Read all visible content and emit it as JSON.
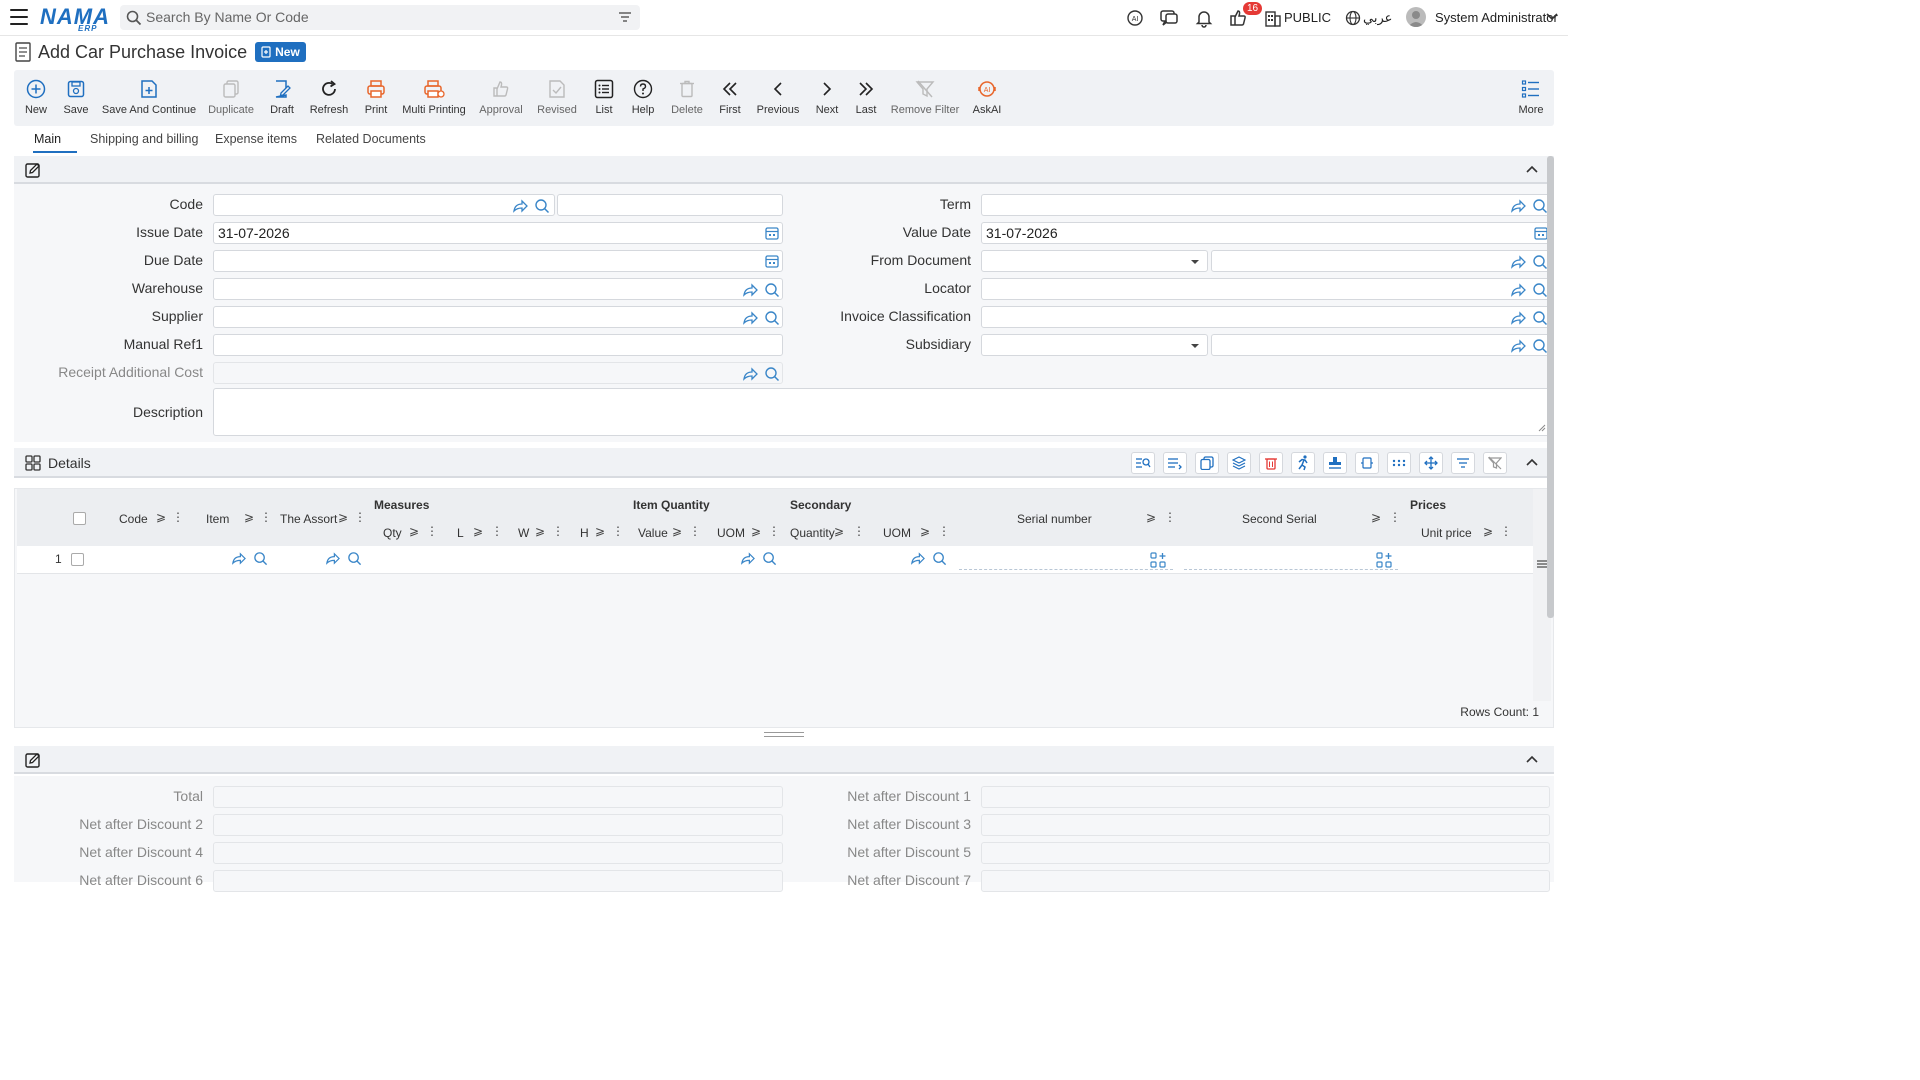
{
  "app": {
    "logo": "NAMA",
    "logo_sub": "ERP"
  },
  "search": {
    "placeholder": "Search By Name Or Code"
  },
  "topbar": {
    "notification_count": "16",
    "public_label": "PUBLIC",
    "language_label": "عربي",
    "user_name": "System Administrator"
  },
  "page": {
    "title": "Add Car Purchase Invoice",
    "status_badge": "New"
  },
  "toolbar": {
    "new": "New",
    "save": "Save",
    "save_continue": "Save And Continue",
    "duplicate": "Duplicate",
    "draft": "Draft",
    "refresh": "Refresh",
    "print": "Print",
    "multi_printing": "Multi Printing",
    "approval": "Approval",
    "revised": "Revised",
    "list": "List",
    "help": "Help",
    "delete": "Delete",
    "first": "First",
    "previous": "Previous",
    "next": "Next",
    "last": "Last",
    "remove_filter": "Remove Filter",
    "askai": "AskAI",
    "more": "More"
  },
  "tabs": [
    "Main",
    "Shipping and billing",
    "Expense items",
    "Related Documents"
  ],
  "form": {
    "code": {
      "label": "Code",
      "value": ""
    },
    "issue_date": {
      "label": "Issue Date",
      "value": "31-07-2026"
    },
    "due_date": {
      "label": "Due Date",
      "value": ""
    },
    "warehouse": {
      "label": "Warehouse",
      "value": ""
    },
    "supplier": {
      "label": "Supplier",
      "value": ""
    },
    "manual_ref1": {
      "label": "Manual Ref1",
      "value": ""
    },
    "receipt_additional_cost": {
      "label": "Receipt Additional Cost",
      "value": ""
    },
    "description": {
      "label": "Description",
      "value": ""
    },
    "term": {
      "label": "Term",
      "value": ""
    },
    "value_date": {
      "label": "Value Date",
      "value": "31-07-2026"
    },
    "from_document": {
      "label": "From Document",
      "value": ""
    },
    "locator": {
      "label": "Locator",
      "value": ""
    },
    "invoice_classification": {
      "label": "Invoice Classification",
      "value": ""
    },
    "subsidiary": {
      "label": "Subsidiary",
      "value": ""
    }
  },
  "details": {
    "title": "Details",
    "group_headers": {
      "measures": "Measures",
      "item_quantity": "Item Quantity",
      "secondary": "Secondary",
      "prices": "Prices"
    },
    "columns": {
      "code": "Code",
      "item": "Item",
      "assortment": "The Assort",
      "qty": "Qty",
      "l": "L",
      "w": "W",
      "h": "H",
      "value": "Value",
      "uom": "UOM",
      "quantity": "Quantity",
      "uom2": "UOM",
      "serial_number": "Serial number",
      "second_serial": "Second Serial",
      "unit_price": "Unit price"
    },
    "rows": [
      {
        "index": "1"
      }
    ],
    "rows_count": "Rows Count: 1"
  },
  "totals": {
    "total": "Total",
    "net_after_discount_1": "Net after Discount 1",
    "net_after_discount_2": "Net after Discount 2",
    "net_after_discount_3": "Net after Discount 3",
    "net_after_discount_4": "Net after Discount 4",
    "net_after_discount_5": "Net after Discount 5",
    "net_after_discount_6": "Net after Discount 6",
    "net_after_discount_7": "Net after Discount 7"
  },
  "colors": {
    "accent": "#1f6fc0",
    "badge_red": "#e53935",
    "print_orange": "#e8662b",
    "link_icon": "#3a86c8"
  }
}
